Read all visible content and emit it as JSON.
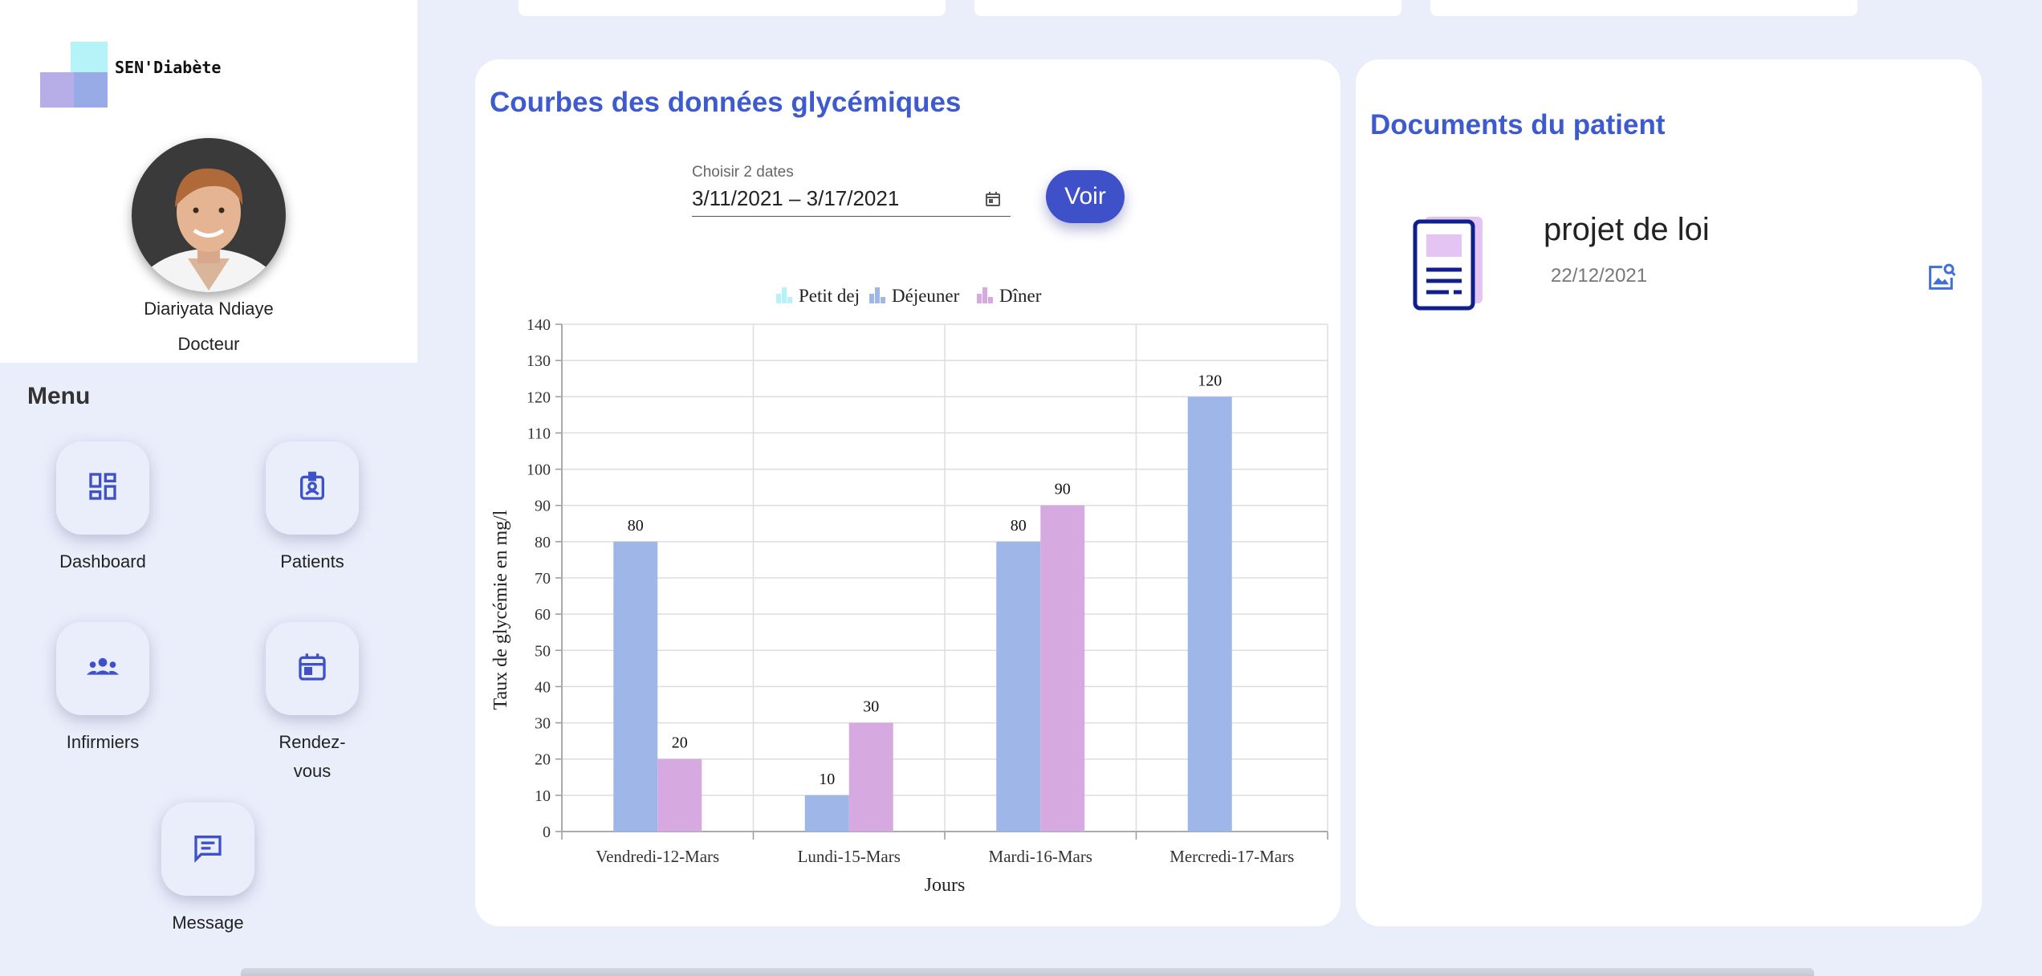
{
  "brand": {
    "name": "SEN'Diabète"
  },
  "profile": {
    "name": "Diariyata Ndiaye",
    "role": "Docteur"
  },
  "menu": {
    "title": "Menu",
    "items": [
      {
        "label": "Dashboard",
        "icon": "dashboard-icon"
      },
      {
        "label": "Patients",
        "icon": "badge-icon"
      },
      {
        "label": "Infirmiers",
        "icon": "group-icon"
      },
      {
        "label": "Rendez-vous",
        "icon": "calendar-icon"
      },
      {
        "label": "Message",
        "icon": "message-icon"
      }
    ]
  },
  "glycemia": {
    "title": "Courbes des données glycémiques",
    "date_label": "Choisir 2 dates",
    "date_value": "3/11/2021 – 3/17/2021",
    "view_button": "Voir"
  },
  "documents": {
    "title": "Documents du patient",
    "items": [
      {
        "title": "projet de loi",
        "date": "22/12/2021"
      }
    ]
  },
  "colors": {
    "accent": "#3f51c8",
    "title": "#3d5bcf",
    "petit_dej": "#b6f3f8",
    "dejeuner": "#9fb6e8",
    "diner": "#d6aae0"
  },
  "chart_data": {
    "type": "bar",
    "categories": [
      "Vendredi-12-Mars",
      "Lundi-15-Mars",
      "Mardi-16-Mars",
      "Mercredi-17-Mars"
    ],
    "series": [
      {
        "name": "Petit dej",
        "values": [
          null,
          null,
          null,
          null
        ]
      },
      {
        "name": "Déjeuner",
        "values": [
          80,
          10,
          80,
          120
        ]
      },
      {
        "name": "Dîner",
        "values": [
          20,
          30,
          90,
          null
        ]
      }
    ],
    "xlabel": "Jours",
    "ylabel": "Taux de glycémie en mg/l",
    "ylim": [
      0,
      140
    ],
    "yticks": [
      0,
      10,
      20,
      30,
      40,
      50,
      60,
      70,
      80,
      90,
      100,
      110,
      120,
      130,
      140
    ],
    "legend_position": "top",
    "grid": true
  }
}
